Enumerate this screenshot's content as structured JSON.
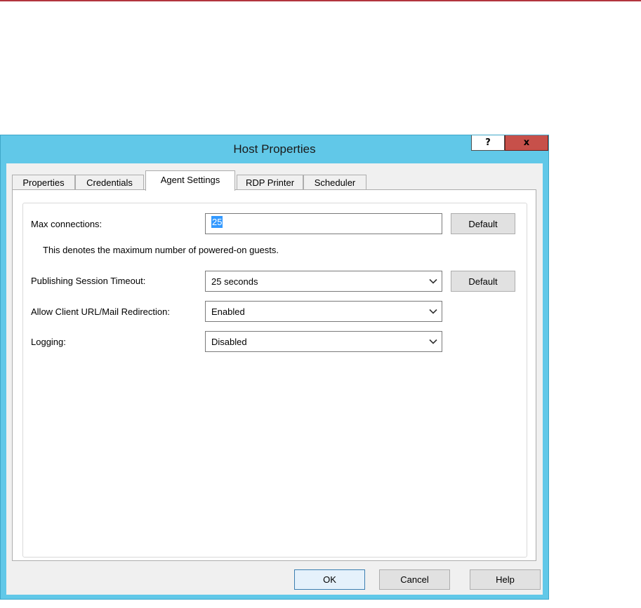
{
  "window": {
    "title": "Host Properties",
    "help_glyph": "?",
    "close_glyph": "x"
  },
  "tabs": [
    {
      "label": "Properties",
      "active": false
    },
    {
      "label": "Credentials",
      "active": false
    },
    {
      "label": "Agent Settings",
      "active": true
    },
    {
      "label": "RDP Printer",
      "active": false
    },
    {
      "label": "Scheduler",
      "active": false
    }
  ],
  "agent_settings": {
    "max_connections": {
      "label": "Max connections:",
      "value": "25",
      "note": "This denotes the maximum number of powered-on guests.",
      "default_label": "Default"
    },
    "session_timeout": {
      "label": "Publishing Session Timeout:",
      "value": "25 seconds",
      "default_label": "Default"
    },
    "url_redirection": {
      "label": "Allow Client URL/Mail Redirection:",
      "value": "Enabled"
    },
    "logging": {
      "label": "Logging:",
      "value": "Disabled"
    }
  },
  "footer": {
    "ok": "OK",
    "cancel": "Cancel",
    "help": "Help"
  },
  "colors": {
    "title_bar": "#61c8e8",
    "close_button": "#c7504a",
    "selection": "#3399ff",
    "top_line": "#b2353d"
  }
}
